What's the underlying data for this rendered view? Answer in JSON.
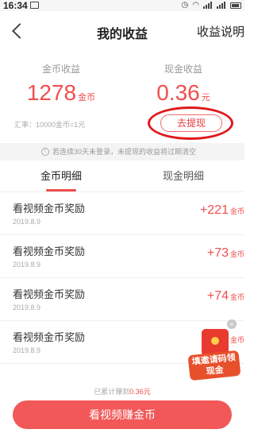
{
  "status_bar": {
    "time": "16:34"
  },
  "header": {
    "title": "我的收益",
    "right_link": "收益说明"
  },
  "summary": {
    "coin": {
      "label": "金币收益",
      "value": "1278",
      "unit": "金币"
    },
    "cash": {
      "label": "现金收益",
      "value": "0.36",
      "unit": "元"
    },
    "exchange_rate": "汇率：10000金币=1元",
    "withdraw_label": "去提现"
  },
  "notice": "若连续30天未登录，未提现的收益将过期清空",
  "tabs": [
    {
      "label": "金币明细",
      "active": true
    },
    {
      "label": "现金明细",
      "active": false
    }
  ],
  "records": [
    {
      "title": "看视频金币奖励",
      "date": "2019.8.9",
      "amount": "+221",
      "unit": "金币"
    },
    {
      "title": "看视频金币奖励",
      "date": "2019.8.9",
      "amount": "+73",
      "unit": "金币"
    },
    {
      "title": "看视频金币奖励",
      "date": "2019.8.9",
      "amount": "+74",
      "unit": "金币"
    },
    {
      "title": "看视频金币奖励",
      "date": "2019.8.9",
      "amount": "+",
      "unit": "金币"
    }
  ],
  "promo": {
    "text": "填邀请码领现金",
    "close": "×"
  },
  "footer": {
    "total_label": "已累计赚到",
    "total_value": "0.36元",
    "cta_label": "看视频赚金币"
  },
  "colors": {
    "accent": "#f04e4e",
    "button": "#f25858",
    "highlight_circle": "#e0191c"
  }
}
